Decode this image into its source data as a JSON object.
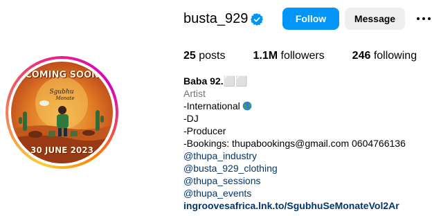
{
  "profile": {
    "username": "busta_929",
    "verified": true,
    "follow_label": "Follow",
    "message_label": "Message",
    "avatar": {
      "top_text": "COMING SOON",
      "bottom_text": "30 JUNE 2023"
    }
  },
  "stats": {
    "posts_count": "25",
    "posts_label": "posts",
    "followers_count": "1.1M",
    "followers_label": "followers",
    "following_count": "246",
    "following_label": "following"
  },
  "bio": {
    "name": "Baba 92.⬜⬜",
    "category": "Artist",
    "lines": [
      "-International",
      "-DJ",
      "-Producer",
      "-Bookings: thupabookings@gmail.com 0604766136"
    ],
    "mentions": [
      "@thupa_industry",
      "@busta_929_clothing",
      "@thupa_sessions",
      "@thupa_events"
    ],
    "link": "ingroovesafrica.lnk.to/SgubhuSeMonateVol2Ar"
  },
  "icons": {
    "verified": "verified-badge-icon",
    "more": "more-options-icon",
    "globe": "globe-emoji-icon"
  },
  "colors": {
    "follow_button": "#0095f6",
    "message_button": "#efefef",
    "verified_badge": "#0095f6",
    "mention_link": "#00376b",
    "category": "#737373"
  }
}
